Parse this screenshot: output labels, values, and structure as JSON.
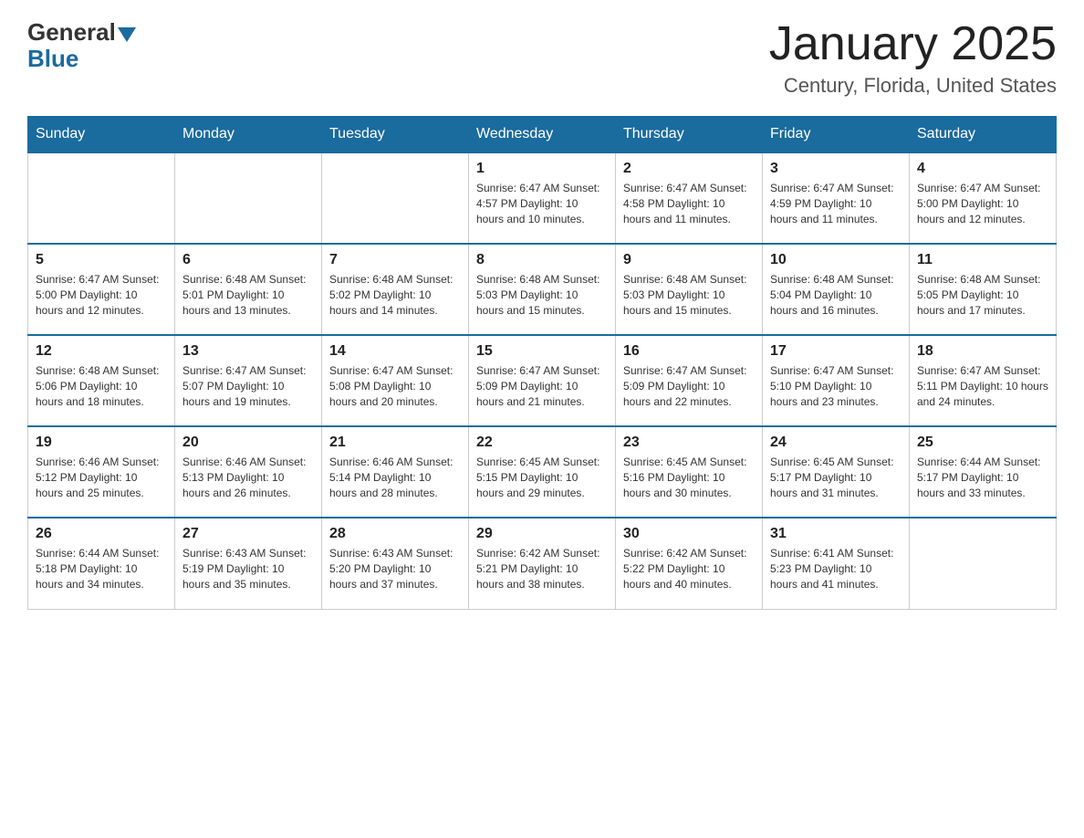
{
  "header": {
    "logo_general": "General",
    "logo_blue": "Blue",
    "month_title": "January 2025",
    "location": "Century, Florida, United States"
  },
  "days_of_week": [
    "Sunday",
    "Monday",
    "Tuesday",
    "Wednesday",
    "Thursday",
    "Friday",
    "Saturday"
  ],
  "weeks": [
    [
      {
        "day": "",
        "info": ""
      },
      {
        "day": "",
        "info": ""
      },
      {
        "day": "",
        "info": ""
      },
      {
        "day": "1",
        "info": "Sunrise: 6:47 AM\nSunset: 4:57 PM\nDaylight: 10 hours\nand 10 minutes."
      },
      {
        "day": "2",
        "info": "Sunrise: 6:47 AM\nSunset: 4:58 PM\nDaylight: 10 hours\nand 11 minutes."
      },
      {
        "day": "3",
        "info": "Sunrise: 6:47 AM\nSunset: 4:59 PM\nDaylight: 10 hours\nand 11 minutes."
      },
      {
        "day": "4",
        "info": "Sunrise: 6:47 AM\nSunset: 5:00 PM\nDaylight: 10 hours\nand 12 minutes."
      }
    ],
    [
      {
        "day": "5",
        "info": "Sunrise: 6:47 AM\nSunset: 5:00 PM\nDaylight: 10 hours\nand 12 minutes."
      },
      {
        "day": "6",
        "info": "Sunrise: 6:48 AM\nSunset: 5:01 PM\nDaylight: 10 hours\nand 13 minutes."
      },
      {
        "day": "7",
        "info": "Sunrise: 6:48 AM\nSunset: 5:02 PM\nDaylight: 10 hours\nand 14 minutes."
      },
      {
        "day": "8",
        "info": "Sunrise: 6:48 AM\nSunset: 5:03 PM\nDaylight: 10 hours\nand 15 minutes."
      },
      {
        "day": "9",
        "info": "Sunrise: 6:48 AM\nSunset: 5:03 PM\nDaylight: 10 hours\nand 15 minutes."
      },
      {
        "day": "10",
        "info": "Sunrise: 6:48 AM\nSunset: 5:04 PM\nDaylight: 10 hours\nand 16 minutes."
      },
      {
        "day": "11",
        "info": "Sunrise: 6:48 AM\nSunset: 5:05 PM\nDaylight: 10 hours\nand 17 minutes."
      }
    ],
    [
      {
        "day": "12",
        "info": "Sunrise: 6:48 AM\nSunset: 5:06 PM\nDaylight: 10 hours\nand 18 minutes."
      },
      {
        "day": "13",
        "info": "Sunrise: 6:47 AM\nSunset: 5:07 PM\nDaylight: 10 hours\nand 19 minutes."
      },
      {
        "day": "14",
        "info": "Sunrise: 6:47 AM\nSunset: 5:08 PM\nDaylight: 10 hours\nand 20 minutes."
      },
      {
        "day": "15",
        "info": "Sunrise: 6:47 AM\nSunset: 5:09 PM\nDaylight: 10 hours\nand 21 minutes."
      },
      {
        "day": "16",
        "info": "Sunrise: 6:47 AM\nSunset: 5:09 PM\nDaylight: 10 hours\nand 22 minutes."
      },
      {
        "day": "17",
        "info": "Sunrise: 6:47 AM\nSunset: 5:10 PM\nDaylight: 10 hours\nand 23 minutes."
      },
      {
        "day": "18",
        "info": "Sunrise: 6:47 AM\nSunset: 5:11 PM\nDaylight: 10 hours\nand 24 minutes."
      }
    ],
    [
      {
        "day": "19",
        "info": "Sunrise: 6:46 AM\nSunset: 5:12 PM\nDaylight: 10 hours\nand 25 minutes."
      },
      {
        "day": "20",
        "info": "Sunrise: 6:46 AM\nSunset: 5:13 PM\nDaylight: 10 hours\nand 26 minutes."
      },
      {
        "day": "21",
        "info": "Sunrise: 6:46 AM\nSunset: 5:14 PM\nDaylight: 10 hours\nand 28 minutes."
      },
      {
        "day": "22",
        "info": "Sunrise: 6:45 AM\nSunset: 5:15 PM\nDaylight: 10 hours\nand 29 minutes."
      },
      {
        "day": "23",
        "info": "Sunrise: 6:45 AM\nSunset: 5:16 PM\nDaylight: 10 hours\nand 30 minutes."
      },
      {
        "day": "24",
        "info": "Sunrise: 6:45 AM\nSunset: 5:17 PM\nDaylight: 10 hours\nand 31 minutes."
      },
      {
        "day": "25",
        "info": "Sunrise: 6:44 AM\nSunset: 5:17 PM\nDaylight: 10 hours\nand 33 minutes."
      }
    ],
    [
      {
        "day": "26",
        "info": "Sunrise: 6:44 AM\nSunset: 5:18 PM\nDaylight: 10 hours\nand 34 minutes."
      },
      {
        "day": "27",
        "info": "Sunrise: 6:43 AM\nSunset: 5:19 PM\nDaylight: 10 hours\nand 35 minutes."
      },
      {
        "day": "28",
        "info": "Sunrise: 6:43 AM\nSunset: 5:20 PM\nDaylight: 10 hours\nand 37 minutes."
      },
      {
        "day": "29",
        "info": "Sunrise: 6:42 AM\nSunset: 5:21 PM\nDaylight: 10 hours\nand 38 minutes."
      },
      {
        "day": "30",
        "info": "Sunrise: 6:42 AM\nSunset: 5:22 PM\nDaylight: 10 hours\nand 40 minutes."
      },
      {
        "day": "31",
        "info": "Sunrise: 6:41 AM\nSunset: 5:23 PM\nDaylight: 10 hours\nand 41 minutes."
      },
      {
        "day": "",
        "info": ""
      }
    ]
  ]
}
